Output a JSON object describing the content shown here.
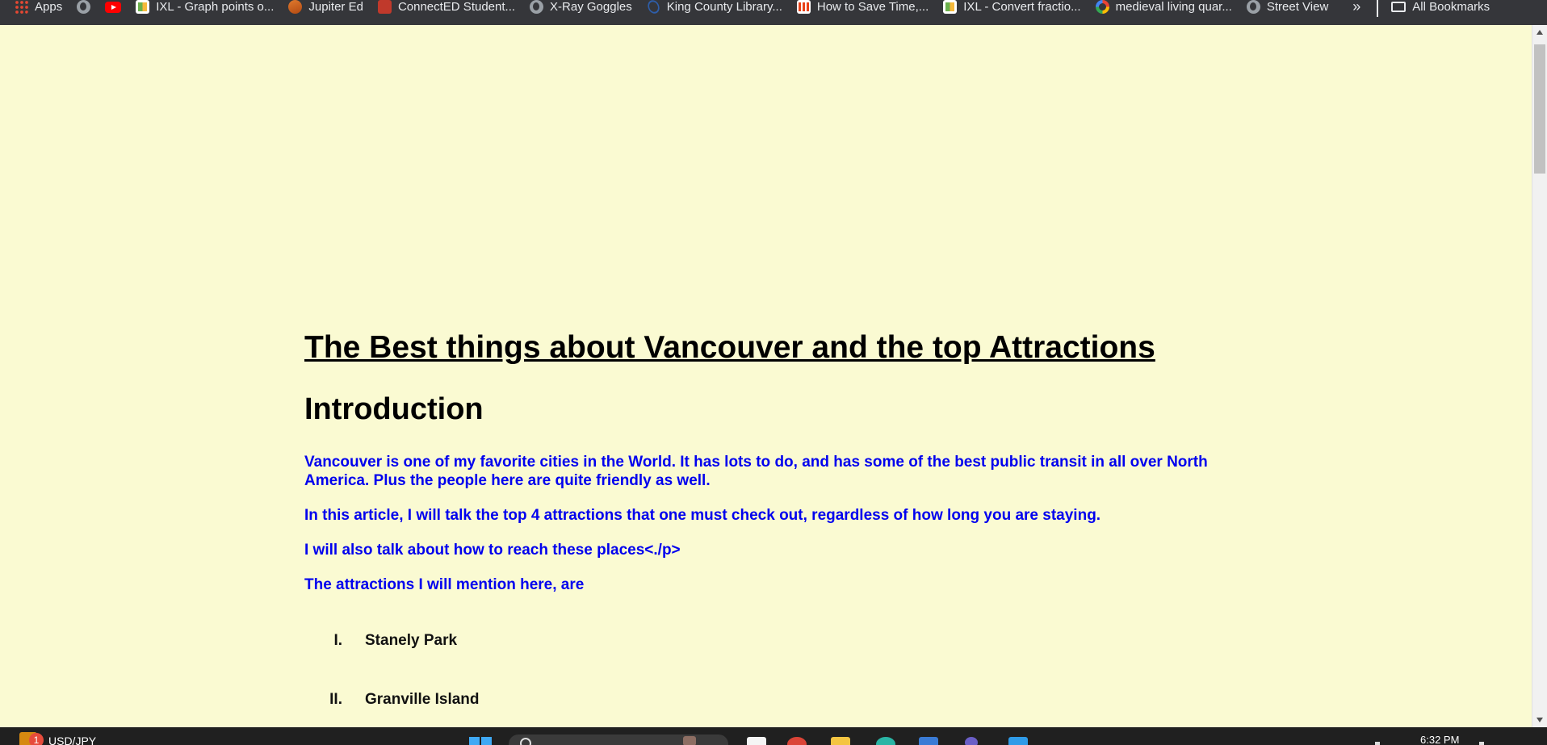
{
  "bookmarks": [
    {
      "label": "Apps",
      "icon": "apps-grid-icon"
    },
    {
      "label": "",
      "icon": "globe-icon"
    },
    {
      "label": "",
      "icon": "youtube-icon"
    },
    {
      "label": "IXL - Graph points o...",
      "icon": "ixl-icon"
    },
    {
      "label": "Jupiter Ed",
      "icon": "jupiter-ed-icon"
    },
    {
      "label": "ConnectED Student...",
      "icon": "connected-icon"
    },
    {
      "label": "X-Ray Goggles",
      "icon": "globe-icon"
    },
    {
      "label": "King County Library...",
      "icon": "kcls-icon"
    },
    {
      "label": "How to Save Time,...",
      "icon": "mcgraw-icon"
    },
    {
      "label": "IXL - Convert fractio...",
      "icon": "ixl-icon"
    },
    {
      "label": "medieval living quar...",
      "icon": "google-icon"
    },
    {
      "label": "Street View",
      "icon": "globe-icon"
    }
  ],
  "bookmarks_more": "»",
  "all_bookmarks": "All Bookmarks",
  "page": {
    "title": "The Best things about Vancouver and the top Attractions",
    "intro_heading": "Introduction",
    "paragraphs": [
      "Vancouver is one of my favorite cities in the World. It has lots to do, and has some of the best public transit in all over North America. Plus the people here are quite friendly as well.",
      "In this article, I will talk the top 4 attractions that one must check out, regardless of how long you are staying.",
      "I will also talk about how to reach these places<./p>",
      "The attractions I will mention here, are"
    ],
    "attractions": [
      {
        "num": "I.",
        "label": "Stanely Park"
      },
      {
        "num": "II.",
        "label": "Granville Island"
      }
    ]
  },
  "taskbar": {
    "badge": "1",
    "ticker": "USD/JPY",
    "time": "6:32 PM"
  },
  "colors": {
    "page_background": "#fafad2",
    "paragraph_text": "#0000ee",
    "bookmarks_bar": "#35363a",
    "taskbar": "#202020"
  }
}
